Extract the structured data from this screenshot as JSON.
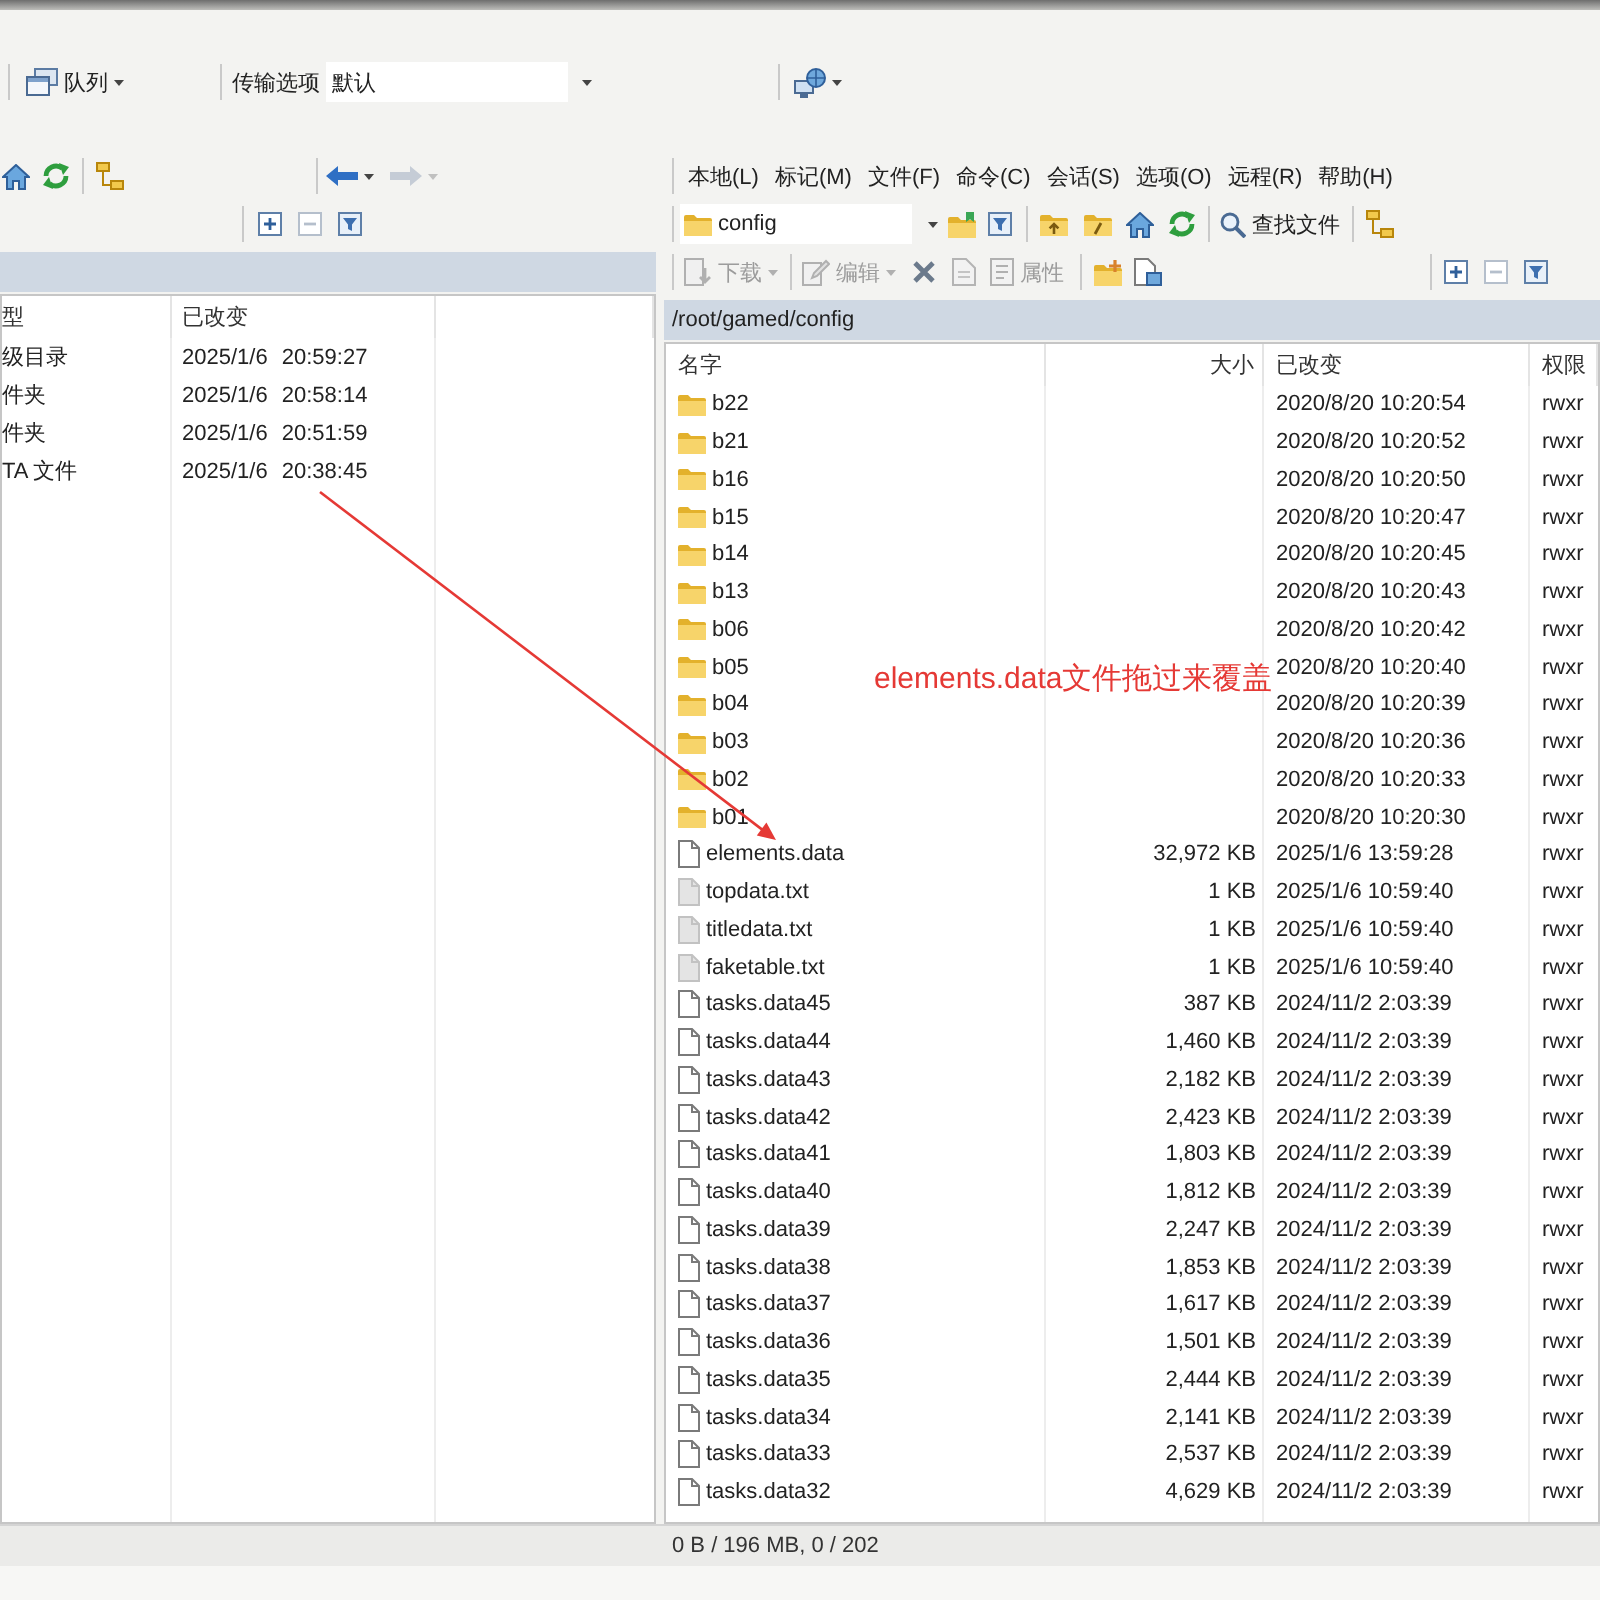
{
  "queue_toolbar": {
    "queue_label": "队列",
    "transfer_options_label": "传输选项",
    "transfer_preset": "默认"
  },
  "left_panel": {
    "columns": [
      "型",
      "已改变"
    ],
    "rows": [
      {
        "type": "级目录",
        "modified": "2025/1/6 20:59:27"
      },
      {
        "type": "件夹",
        "modified": "2025/1/6 20:58:14"
      },
      {
        "type": "件夹",
        "modified": "2025/1/6 20:51:59"
      },
      {
        "type": "TA 文件",
        "modified": "2025/1/6 20:38:45"
      }
    ]
  },
  "right_panel": {
    "menu": [
      "本地(L)",
      "标记(M)",
      "文件(F)",
      "命令(C)",
      "会话(S)",
      "选项(O)",
      "远程(R)",
      "帮助(H)"
    ],
    "location": "config",
    "find_files_label": "查找文件",
    "download_button": {
      "label": "下载",
      "disabled": true
    },
    "edit_button": {
      "label": "编辑",
      "disabled": true
    },
    "properties_button": {
      "label": "属性",
      "disabled": true
    },
    "path": "/root/gamed/config",
    "columns": [
      "名字",
      "大小",
      "已改变",
      "权限"
    ],
    "rows": [
      {
        "kind": "folder",
        "name": "b22",
        "modified": "2020/8/20 10:20:54",
        "permissions": "rwxr"
      },
      {
        "kind": "folder",
        "name": "b21",
        "modified": "2020/8/20 10:20:52",
        "permissions": "rwxr"
      },
      {
        "kind": "folder",
        "name": "b16",
        "modified": "2020/8/20 10:20:50",
        "permissions": "rwxr"
      },
      {
        "kind": "folder",
        "name": "b15",
        "modified": "2020/8/20 10:20:47",
        "permissions": "rwxr"
      },
      {
        "kind": "folder",
        "name": "b14",
        "modified": "2020/8/20 10:20:45",
        "permissions": "rwxr"
      },
      {
        "kind": "folder",
        "name": "b13",
        "modified": "2020/8/20 10:20:43",
        "permissions": "rwxr"
      },
      {
        "kind": "folder",
        "name": "b06",
        "modified": "2020/8/20 10:20:42",
        "permissions": "rwxr"
      },
      {
        "kind": "folder",
        "name": "b05",
        "modified": "2020/8/20 10:20:40",
        "permissions": "rwxr"
      },
      {
        "kind": "folder",
        "name": "b04",
        "modified": "2020/8/20 10:20:39",
        "permissions": "rwxr"
      },
      {
        "kind": "folder",
        "name": "b03",
        "modified": "2020/8/20 10:20:36",
        "permissions": "rwxr"
      },
      {
        "kind": "folder",
        "name": "b02",
        "modified": "2020/8/20 10:20:33",
        "permissions": "rwxr"
      },
      {
        "kind": "folder",
        "name": "b01",
        "modified": "2020/8/20 10:20:30",
        "permissions": "rwxr"
      },
      {
        "kind": "file",
        "name": "elements.data",
        "size": "32,972 KB",
        "modified": "2025/1/6 13:59:28",
        "permissions": "rwxr"
      },
      {
        "kind": "text",
        "name": "topdata.txt",
        "size": "1 KB",
        "modified": "2025/1/6 10:59:40",
        "permissions": "rwxr"
      },
      {
        "kind": "text",
        "name": "titledata.txt",
        "size": "1 KB",
        "modified": "2025/1/6 10:59:40",
        "permissions": "rwxr"
      },
      {
        "kind": "text",
        "name": "faketable.txt",
        "size": "1 KB",
        "modified": "2025/1/6 10:59:40",
        "permissions": "rwxr"
      },
      {
        "kind": "file",
        "name": "tasks.data45",
        "size": "387 KB",
        "modified": "2024/11/2 2:03:39",
        "permissions": "rwxr"
      },
      {
        "kind": "file",
        "name": "tasks.data44",
        "size": "1,460 KB",
        "modified": "2024/11/2 2:03:39",
        "permissions": "rwxr"
      },
      {
        "kind": "file",
        "name": "tasks.data43",
        "size": "2,182 KB",
        "modified": "2024/11/2 2:03:39",
        "permissions": "rwxr"
      },
      {
        "kind": "file",
        "name": "tasks.data42",
        "size": "2,423 KB",
        "modified": "2024/11/2 2:03:39",
        "permissions": "rwxr"
      },
      {
        "kind": "file",
        "name": "tasks.data41",
        "size": "1,803 KB",
        "modified": "2024/11/2 2:03:39",
        "permissions": "rwxr"
      },
      {
        "kind": "file",
        "name": "tasks.data40",
        "size": "1,812 KB",
        "modified": "2024/11/2 2:03:39",
        "permissions": "rwxr"
      },
      {
        "kind": "file",
        "name": "tasks.data39",
        "size": "2,247 KB",
        "modified": "2024/11/2 2:03:39",
        "permissions": "rwxr"
      },
      {
        "kind": "file",
        "name": "tasks.data38",
        "size": "1,853 KB",
        "modified": "2024/11/2 2:03:39",
        "permissions": "rwxr"
      },
      {
        "kind": "file",
        "name": "tasks.data37",
        "size": "1,617 KB",
        "modified": "2024/11/2 2:03:39",
        "permissions": "rwxr"
      },
      {
        "kind": "file",
        "name": "tasks.data36",
        "size": "1,501 KB",
        "modified": "2024/11/2 2:03:39",
        "permissions": "rwxr"
      },
      {
        "kind": "file",
        "name": "tasks.data35",
        "size": "2,444 KB",
        "modified": "2024/11/2 2:03:39",
        "permissions": "rwxr"
      },
      {
        "kind": "file",
        "name": "tasks.data34",
        "size": "2,141 KB",
        "modified": "2024/11/2 2:03:39",
        "permissions": "rwxr"
      },
      {
        "kind": "file",
        "name": "tasks.data33",
        "size": "2,537 KB",
        "modified": "2024/11/2 2:03:39",
        "permissions": "rwxr"
      },
      {
        "kind": "file",
        "name": "tasks.data32",
        "size": "4,629 KB",
        "modified": "2024/11/2 2:03:39",
        "permissions": "rwxr"
      }
    ]
  },
  "status_bar": {
    "text": "0 B / 196 MB, 0 / 202"
  },
  "annotation": {
    "text": "elements.data文件拖过来覆盖"
  }
}
